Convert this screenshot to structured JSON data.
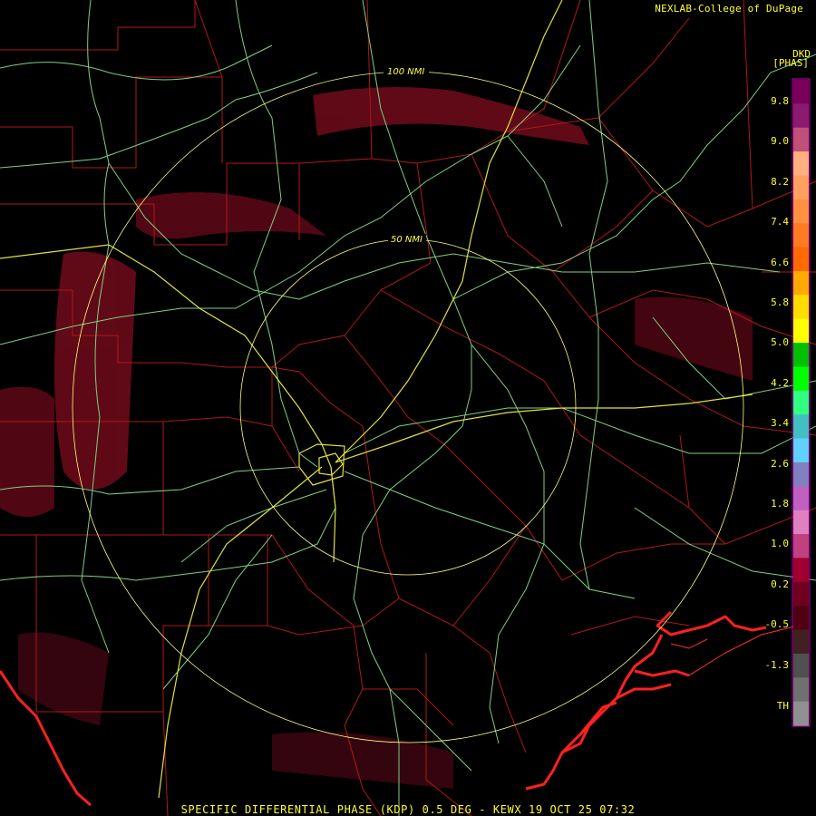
{
  "header": {
    "credit": "NEXLAB-College of DuPage"
  },
  "product": {
    "code": "DKD",
    "unit": "[PHAS]",
    "footer": "SPECIFIC DIFFERENTIAL PHASE (KDP) 0.5 DEG - KEWX 19 OCT 25 07:32"
  },
  "range_rings": [
    {
      "label": "100 NMI",
      "nmi": 100
    },
    {
      "label": "50 NMI",
      "nmi": 50
    }
  ],
  "legend": {
    "ticks": [
      "9.8",
      "9.0",
      "8.2",
      "7.4",
      "6.6",
      "5.8",
      "5.0",
      "4.2",
      "3.4",
      "2.6",
      "1.8",
      "1.0",
      "0.2",
      "-0.5",
      "-1.3",
      "TH"
    ],
    "colors": [
      "#7a005a",
      "#8c1a6e",
      "#c05078",
      "#ffb080",
      "#ffa060",
      "#ff9040",
      "#ff7a20",
      "#ff6a00",
      "#ffaa00",
      "#ffdd00",
      "#ffff00",
      "#00c000",
      "#00ff00",
      "#30ff80",
      "#40c0c0",
      "#60d0ff",
      "#8080c0",
      "#c060c0",
      "#e080c0",
      "#c04080",
      "#a00030",
      "#700020",
      "#500010",
      "#402020",
      "#505050",
      "#707070",
      "#909090"
    ]
  },
  "colors": {
    "county_lines": "#b01818",
    "highways": "#80d080",
    "interstates": "#e0e040",
    "coast": "#ff2020",
    "rings": "#ffff80",
    "echo": "#7a1020",
    "text": "#ffff33"
  }
}
